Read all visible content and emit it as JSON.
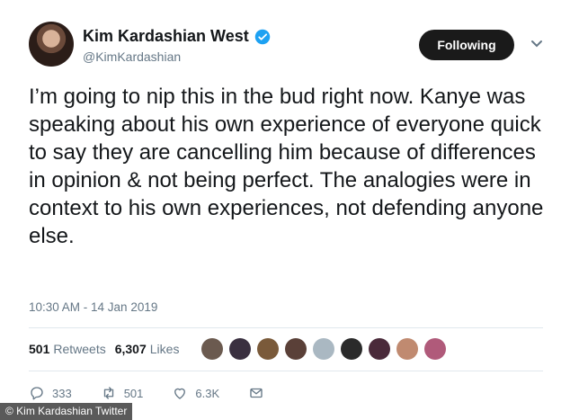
{
  "user": {
    "display_name": "Kim Kardashian West",
    "handle": "@KimKardashian"
  },
  "follow_button": {
    "label": "Following"
  },
  "tweet": {
    "text": "I’m going to nip this in the bud right now. Kanye was speaking about his own experience of everyone quick to say they are cancelling him because of differences in opinion & not being perfect. The analogies were in context to his own experiences, not defending anyone else.",
    "timestamp": "10:30 AM - 14 Jan 2019"
  },
  "stats": {
    "retweets_count": "501",
    "retweets_label": "Retweets",
    "likes_count": "6,307",
    "likes_label": "Likes"
  },
  "liker_avatars": [
    {
      "color": "#6b5a4f"
    },
    {
      "color": "#3a3040"
    },
    {
      "color": "#7a5a3a"
    },
    {
      "color": "#5a4038"
    },
    {
      "color": "#aab8c2"
    },
    {
      "color": "#2a2a2a"
    },
    {
      "color": "#4a2a3a"
    },
    {
      "color": "#c08a70"
    },
    {
      "color": "#b05a7a"
    }
  ],
  "actions": {
    "reply_count": "333",
    "retweet_count": "501",
    "like_count": "6.3K"
  },
  "credit": "© Kim Kardashian Twitter",
  "colors": {
    "verified": "#1da1f2",
    "button_bg": "#1a1a1a",
    "muted": "#657786"
  },
  "icons": [
    "verified-badge-icon",
    "chevron-down-icon",
    "reply-icon",
    "retweet-icon",
    "heart-icon",
    "mail-icon"
  ]
}
